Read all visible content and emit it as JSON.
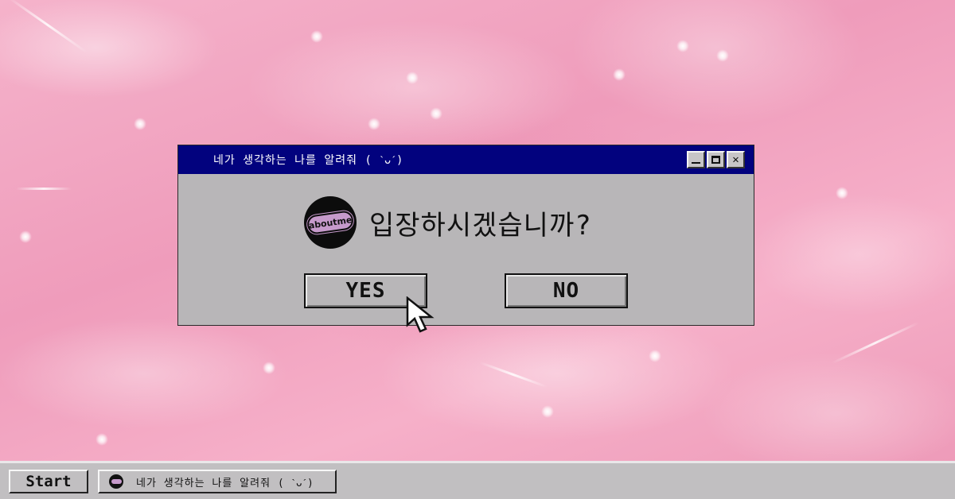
{
  "dialog": {
    "title": "네가 생각하는 나를 알려줘 ( ˋᴗˊ)",
    "logo_text": "aboutme",
    "message": "입장하시겠습니까?",
    "yes_label": "YES",
    "no_label": "NO",
    "controls": {
      "minimize": "_",
      "maximize": "□",
      "close": "✕"
    }
  },
  "taskbar": {
    "start_label": "Start",
    "task_label": "네가 생각하는 나를 알려줘 ( ˋᴗˊ)"
  },
  "colors": {
    "titlebar": "#02027e",
    "window_face": "#b8b6b8",
    "desktop_pink": "#f2a9c4",
    "logo_pill": "#c69acb"
  },
  "icons": {
    "logo": "aboutme-logo-icon",
    "cursor": "arrow-cursor-icon"
  }
}
